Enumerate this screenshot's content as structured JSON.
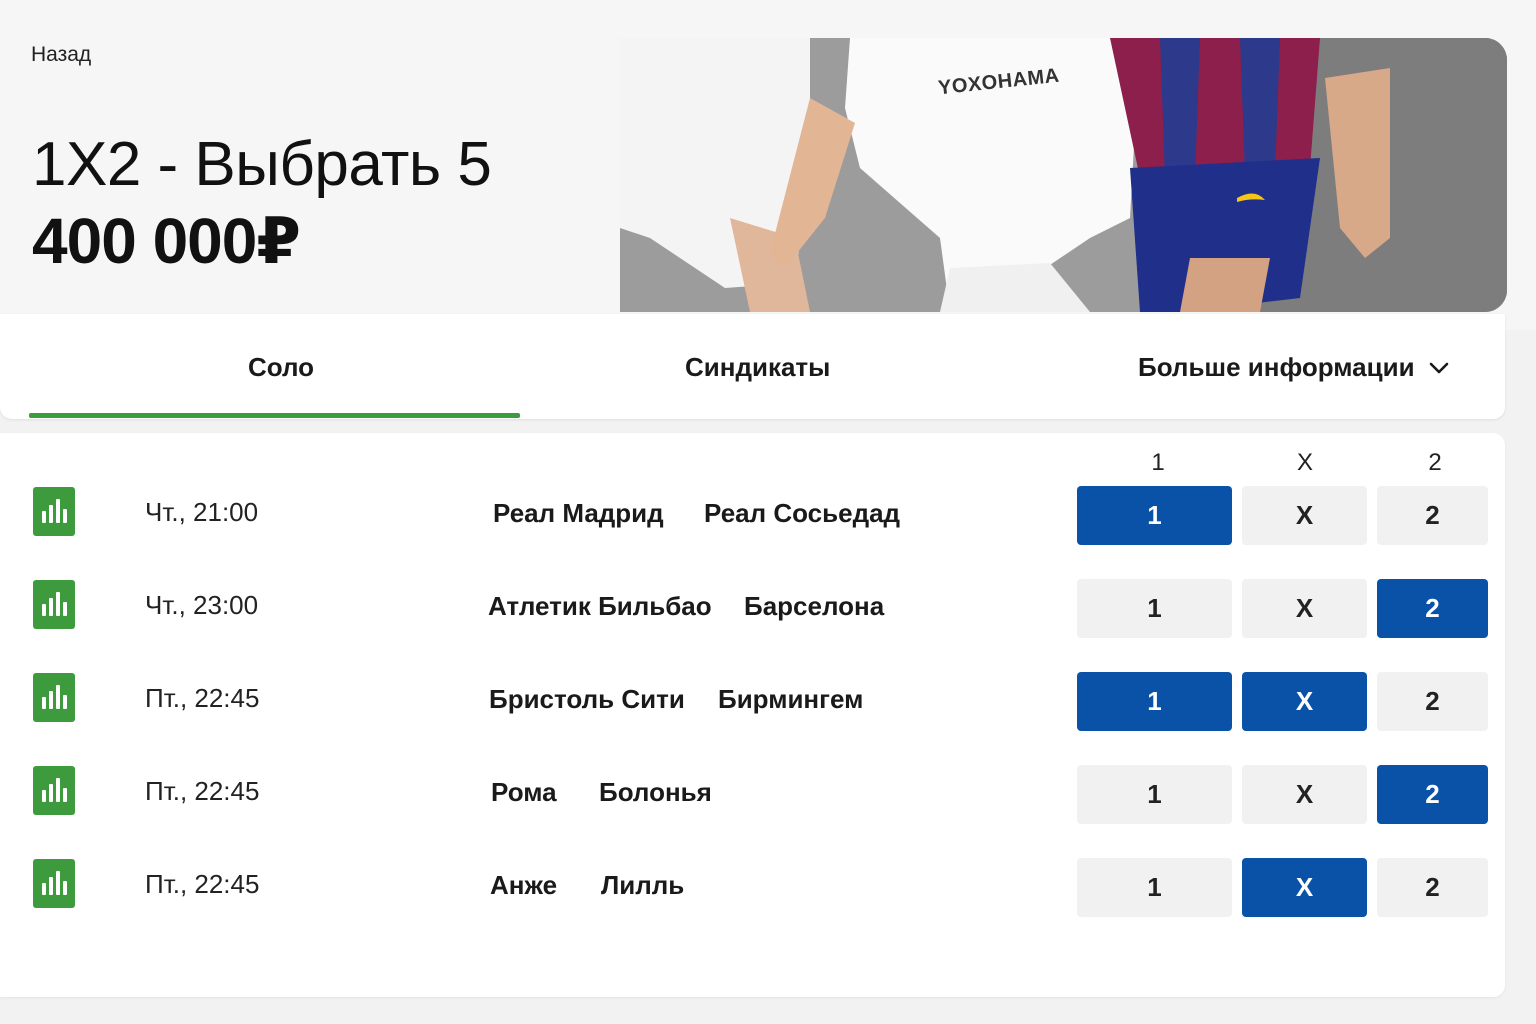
{
  "header": {
    "back_label": "Назад",
    "title": "1X2 - Выбрать 5",
    "jackpot": "400 000₽",
    "banner_text": "YOXOHAMA"
  },
  "tabs": [
    {
      "label": "Соло",
      "active": true
    },
    {
      "label": "Синдикаты",
      "active": false
    },
    {
      "label": "Больше информации",
      "active": false
    }
  ],
  "columns": [
    "1",
    "X",
    "2"
  ],
  "matches": [
    {
      "time": "Чт., 21:00",
      "home": "Реал Мадрид",
      "away": "Реал Сосьедад",
      "picks": [
        "1",
        "X",
        "2"
      ],
      "selected": [
        "1"
      ]
    },
    {
      "time": "Чт., 23:00",
      "home": "Атлетик Бильбао",
      "away": "Барселона",
      "picks": [
        "1",
        "X",
        "2"
      ],
      "selected": [
        "2"
      ]
    },
    {
      "time": "Пт., 22:45",
      "home": "Бристоль Сити",
      "away": "Бирмингем",
      "picks": [
        "1",
        "X",
        "2"
      ],
      "selected": [
        "1",
        "X"
      ]
    },
    {
      "time": "Пт., 22:45",
      "home": "Рома",
      "away": "Болонья",
      "picks": [
        "1",
        "X",
        "2"
      ],
      "selected": [
        "2"
      ]
    },
    {
      "time": "Пт., 22:45",
      "home": "Анже",
      "away": "Лилль",
      "picks": [
        "1",
        "X",
        "2"
      ],
      "selected": [
        "X"
      ]
    }
  ],
  "colors": {
    "accent_green": "#3d9a3d",
    "selected_blue": "#0a52a8",
    "pick_bg": "#f1f1f1"
  }
}
